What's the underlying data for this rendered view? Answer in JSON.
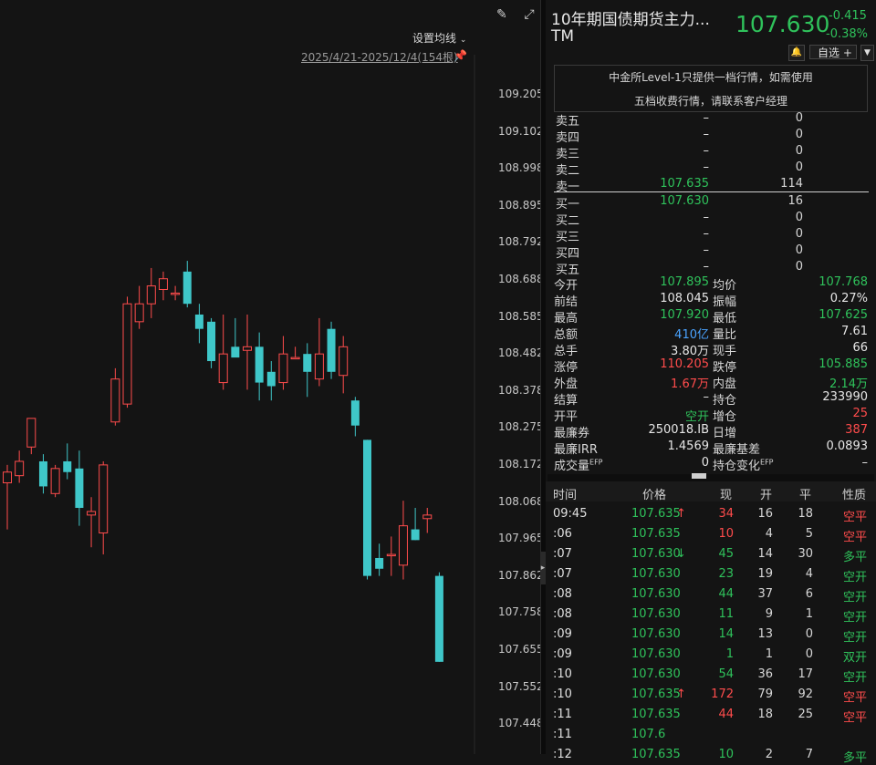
{
  "chart": {
    "toolbar_icons": [
      "brush-icon",
      "fullscreen-icon"
    ],
    "ma_settings_label": "设置均线",
    "date_range": "2025/4/21-2025/12/4(154根)",
    "y_axis_labels": [
      "109.205",
      "109.102",
      "108.998",
      "108.895",
      "108.792",
      "108.688",
      "108.585",
      "108.482",
      "108.378",
      "108.275",
      "108.172",
      "108.068",
      "107.965",
      "107.862",
      "107.758",
      "107.655",
      "107.552",
      "107.448"
    ],
    "up_color": "#ff4c4c",
    "down_color": "#3fc7c9",
    "candles": [
      {
        "o": 108.12,
        "h": 108.17,
        "l": 107.99,
        "c": 108.15
      },
      {
        "o": 108.14,
        "h": 108.21,
        "l": 108.12,
        "c": 108.18
      },
      {
        "o": 108.22,
        "h": 108.3,
        "l": 108.2,
        "c": 108.3
      },
      {
        "o": 108.18,
        "h": 108.2,
        "l": 108.09,
        "c": 108.11
      },
      {
        "o": 108.09,
        "h": 108.17,
        "l": 108.08,
        "c": 108.16
      },
      {
        "o": 108.18,
        "h": 108.23,
        "l": 108.13,
        "c": 108.15
      },
      {
        "o": 108.16,
        "h": 108.21,
        "l": 108.0,
        "c": 108.05
      },
      {
        "o": 108.03,
        "h": 108.08,
        "l": 107.94,
        "c": 108.04
      },
      {
        "o": 107.98,
        "h": 108.18,
        "l": 107.92,
        "c": 108.17
      },
      {
        "o": 108.29,
        "h": 108.44,
        "l": 108.28,
        "c": 108.41
      },
      {
        "o": 108.34,
        "h": 108.64,
        "l": 108.33,
        "c": 108.62
      },
      {
        "o": 108.57,
        "h": 108.67,
        "l": 108.55,
        "c": 108.62
      },
      {
        "o": 108.62,
        "h": 108.72,
        "l": 108.58,
        "c": 108.67
      },
      {
        "o": 108.66,
        "h": 108.71,
        "l": 108.63,
        "c": 108.69
      },
      {
        "o": 108.65,
        "h": 108.67,
        "l": 108.63,
        "c": 108.65
      },
      {
        "o": 108.71,
        "h": 108.74,
        "l": 108.61,
        "c": 108.62
      },
      {
        "o": 108.59,
        "h": 108.62,
        "l": 108.51,
        "c": 108.55
      },
      {
        "o": 108.57,
        "h": 108.58,
        "l": 108.44,
        "c": 108.46
      },
      {
        "o": 108.4,
        "h": 108.59,
        "l": 108.38,
        "c": 108.48
      },
      {
        "o": 108.5,
        "h": 108.58,
        "l": 108.48,
        "c": 108.47
      },
      {
        "o": 108.49,
        "h": 108.59,
        "l": 108.38,
        "c": 108.5
      },
      {
        "o": 108.5,
        "h": 108.54,
        "l": 108.35,
        "c": 108.4
      },
      {
        "o": 108.43,
        "h": 108.46,
        "l": 108.35,
        "c": 108.39
      },
      {
        "o": 108.4,
        "h": 108.53,
        "l": 108.38,
        "c": 108.48
      },
      {
        "o": 108.47,
        "h": 108.5,
        "l": 108.47,
        "c": 108.47
      },
      {
        "o": 108.48,
        "h": 108.51,
        "l": 108.36,
        "c": 108.43
      },
      {
        "o": 108.41,
        "h": 108.58,
        "l": 108.39,
        "c": 108.48
      },
      {
        "o": 108.55,
        "h": 108.57,
        "l": 108.41,
        "c": 108.43
      },
      {
        "o": 108.42,
        "h": 108.53,
        "l": 108.37,
        "c": 108.5
      },
      {
        "o": 108.35,
        "h": 108.36,
        "l": 108.25,
        "c": 108.28
      },
      {
        "o": 108.24,
        "h": 108.24,
        "l": 107.85,
        "c": 107.86
      },
      {
        "o": 107.91,
        "h": 107.95,
        "l": 107.86,
        "c": 107.88
      },
      {
        "o": 107.92,
        "h": 107.97,
        "l": 107.86,
        "c": 107.92
      },
      {
        "o": 107.89,
        "h": 108.07,
        "l": 107.85,
        "c": 108.0
      },
      {
        "o": 107.99,
        "h": 108.05,
        "l": 107.96,
        "c": 107.96
      },
      {
        "o": 108.02,
        "h": 108.05,
        "l": 107.98,
        "c": 108.03
      },
      {
        "o": 107.86,
        "h": 107.87,
        "l": 107.62,
        "c": 107.62
      }
    ]
  },
  "quote": {
    "title": "10年期国债期货主力...",
    "code": "TM",
    "last_price": "107.630",
    "change": "-0.415",
    "change_pct": "-0.38%",
    "bell_icon": "bell-icon",
    "watch_label": "自选 +",
    "notice_line1": "中金所Level-1只提供一档行情，如需使用",
    "notice_line2": "五档收费行情，请联系客户经理",
    "asks": [
      {
        "label": "卖五",
        "price": "–",
        "vol": "0"
      },
      {
        "label": "卖四",
        "price": "–",
        "vol": "0"
      },
      {
        "label": "卖三",
        "price": "–",
        "vol": "0"
      },
      {
        "label": "卖二",
        "price": "–",
        "vol": "0"
      },
      {
        "label": "卖一",
        "price": "107.635",
        "vol": "114"
      }
    ],
    "bids": [
      {
        "label": "买一",
        "price": "107.630",
        "vol": "16"
      },
      {
        "label": "买二",
        "price": "–",
        "vol": "0"
      },
      {
        "label": "买三",
        "price": "–",
        "vol": "0"
      },
      {
        "label": "买四",
        "price": "–",
        "vol": "0"
      },
      {
        "label": "买五",
        "price": "–",
        "vol": "0"
      }
    ],
    "stats": [
      {
        "l1": "今开",
        "v1": "107.895",
        "c1": "green",
        "l2": "均价",
        "v2": "107.768",
        "c2": "green"
      },
      {
        "l1": "前结",
        "v1": "108.045",
        "c1": "white",
        "l2": "振幅",
        "v2": "0.27%",
        "c2": "white"
      },
      {
        "l1": "最高",
        "v1": "107.920",
        "c1": "green",
        "l2": "最低",
        "v2": "107.625",
        "c2": "green"
      },
      {
        "l1": "总额",
        "v1": "410亿",
        "c1": "blue",
        "l2": "量比",
        "v2": "7.61",
        "c2": "white"
      },
      {
        "l1": "总手",
        "v1": "3.80万",
        "c1": "white",
        "l2": "现手",
        "v2": "66",
        "c2": "white"
      },
      {
        "l1": "涨停",
        "v1": "110.205",
        "c1": "red",
        "l2": "跌停",
        "v2": "105.885",
        "c2": "green"
      },
      {
        "l1": "外盘",
        "v1": "1.67万",
        "c1": "red",
        "l2": "内盘",
        "v2": "2.14万",
        "c2": "green"
      },
      {
        "l1": "结算",
        "v1": "–",
        "c1": "white",
        "l2": "持仓",
        "v2": "233990",
        "c2": "white"
      },
      {
        "l1": "开平",
        "v1": "空开",
        "c1": "green",
        "l2": "增仓",
        "v2": "25",
        "c2": "red"
      },
      {
        "l1": "最廉券",
        "v1": "250018.IB",
        "c1": "white",
        "l2": "日增",
        "v2": "387",
        "c2": "red"
      },
      {
        "l1": "最廉IRR",
        "v1": "1.4569",
        "c1": "white",
        "l2": "最廉基差",
        "v2": "0.0893",
        "c2": "white"
      },
      {
        "l1": "成交量EFP",
        "v1": "0",
        "c1": "white",
        "l2": "持仓变化EFP",
        "v2": "–",
        "c2": "white"
      }
    ],
    "tick_headers": [
      "时间",
      "价格",
      "现",
      "开",
      "平",
      "性质"
    ],
    "ticks": [
      {
        "time": "09:45",
        "price": "107.635",
        "arrow": "↑",
        "arrow_color": "red",
        "cur": "34",
        "cur_color": "red",
        "open": "16",
        "close": "18",
        "nature": "空平",
        "nature_color": "red"
      },
      {
        "time": ":06",
        "price": "107.635",
        "arrow": "",
        "arrow_color": "",
        "cur": "10",
        "cur_color": "red",
        "open": "4",
        "close": "5",
        "nature": "空平",
        "nature_color": "red"
      },
      {
        "time": ":07",
        "price": "107.630",
        "arrow": "↓",
        "arrow_color": "green",
        "cur": "45",
        "cur_color": "green",
        "open": "14",
        "close": "30",
        "nature": "多平",
        "nature_color": "green"
      },
      {
        "time": ":07",
        "price": "107.630",
        "arrow": "",
        "arrow_color": "",
        "cur": "23",
        "cur_color": "green",
        "open": "19",
        "close": "4",
        "nature": "空开",
        "nature_color": "green"
      },
      {
        "time": ":08",
        "price": "107.630",
        "arrow": "",
        "arrow_color": "",
        "cur": "44",
        "cur_color": "green",
        "open": "37",
        "close": "6",
        "nature": "空开",
        "nature_color": "green"
      },
      {
        "time": ":08",
        "price": "107.630",
        "arrow": "",
        "arrow_color": "",
        "cur": "11",
        "cur_color": "green",
        "open": "9",
        "close": "1",
        "nature": "空开",
        "nature_color": "green"
      },
      {
        "time": ":09",
        "price": "107.630",
        "arrow": "",
        "arrow_color": "",
        "cur": "14",
        "cur_color": "green",
        "open": "13",
        "close": "0",
        "nature": "空开",
        "nature_color": "green"
      },
      {
        "time": ":09",
        "price": "107.630",
        "arrow": "",
        "arrow_color": "",
        "cur": "1",
        "cur_color": "green",
        "open": "1",
        "close": "0",
        "nature": "双开",
        "nature_color": "green"
      },
      {
        "time": ":10",
        "price": "107.630",
        "arrow": "",
        "arrow_color": "",
        "cur": "54",
        "cur_color": "green",
        "open": "36",
        "close": "17",
        "nature": "空开",
        "nature_color": "green"
      },
      {
        "time": ":10",
        "price": "107.635",
        "arrow": "↑",
        "arrow_color": "red",
        "cur": "172",
        "cur_color": "red",
        "open": "79",
        "close": "92",
        "nature": "空平",
        "nature_color": "red"
      },
      {
        "time": ":11",
        "price": "107.635",
        "arrow": "",
        "arrow_color": "",
        "cur": "44",
        "cur_color": "red",
        "open": "18",
        "close": "25",
        "nature": "空平",
        "nature_color": "red"
      },
      {
        "time": ":11",
        "price": "107.6",
        "arrow": "",
        "arrow_color": "",
        "cur": "",
        "cur_color": "green",
        "open": "",
        "close": "",
        "nature": "",
        "nature_color": "green"
      },
      {
        "time": ":12",
        "price": "107.635",
        "arrow": "",
        "arrow_color": "",
        "cur": "10",
        "cur_color": "green",
        "open": "2",
        "close": "7",
        "nature": "多平",
        "nature_color": "green"
      }
    ]
  }
}
